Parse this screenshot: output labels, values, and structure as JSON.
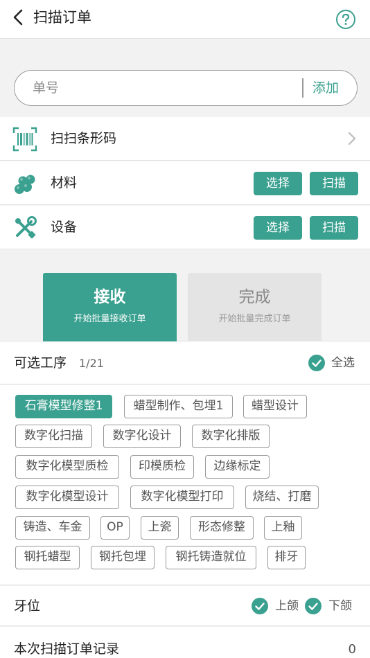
{
  "header": {
    "title": "扫描订单"
  },
  "search": {
    "placeholder": "单号",
    "add_label": "添加"
  },
  "rows": {
    "barcode": {
      "label": "扫扫条形码"
    },
    "material": {
      "label": "材料",
      "select_label": "选择",
      "scan_label": "扫描"
    },
    "device": {
      "label": "设备",
      "select_label": "选择",
      "scan_label": "扫描"
    }
  },
  "modes": [
    {
      "title": "接收",
      "subtitle": "开始批量接收订单",
      "active": true
    },
    {
      "title": "完成",
      "subtitle": "开始批量完成订单",
      "active": false
    }
  ],
  "process": {
    "title": "可选工序",
    "count": "1/21",
    "select_all_label": "全选",
    "select_all_checked": true,
    "tags": [
      {
        "label": "石膏模型修整1",
        "selected": true
      },
      {
        "label": "蜡型制作、包埋1",
        "selected": false
      },
      {
        "label": "蜡型设计",
        "selected": false
      },
      {
        "label": "数字化扫描",
        "selected": false
      },
      {
        "label": "数字化设计",
        "selected": false
      },
      {
        "label": "数字化排版",
        "selected": false
      },
      {
        "label": "数字化模型质检",
        "selected": false
      },
      {
        "label": "印模质检",
        "selected": false
      },
      {
        "label": "边缘标定",
        "selected": false
      },
      {
        "label": "数字化模型设计",
        "selected": false
      },
      {
        "label": "数字化模型打印",
        "selected": false
      },
      {
        "label": "烧结、打磨",
        "selected": false
      },
      {
        "label": "铸造、车金",
        "selected": false
      },
      {
        "label": "OP",
        "selected": false
      },
      {
        "label": "上瓷",
        "selected": false
      },
      {
        "label": "形态修整",
        "selected": false
      },
      {
        "label": "上釉",
        "selected": false
      },
      {
        "label": "钢托蜡型",
        "selected": false
      },
      {
        "label": "钢托包埋",
        "selected": false
      },
      {
        "label": "钢托铸造就位",
        "selected": false
      },
      {
        "label": "排牙",
        "selected": false
      }
    ]
  },
  "teeth": {
    "label": "牙位",
    "upper_label": "上颌",
    "upper_checked": true,
    "lower_label": "下颌",
    "lower_checked": true
  },
  "records": {
    "label": "本次扫描订单记录",
    "count": "0"
  },
  "colors": {
    "accent": "#3aa08f",
    "border": "#999999",
    "background": "#f2f2f2"
  }
}
